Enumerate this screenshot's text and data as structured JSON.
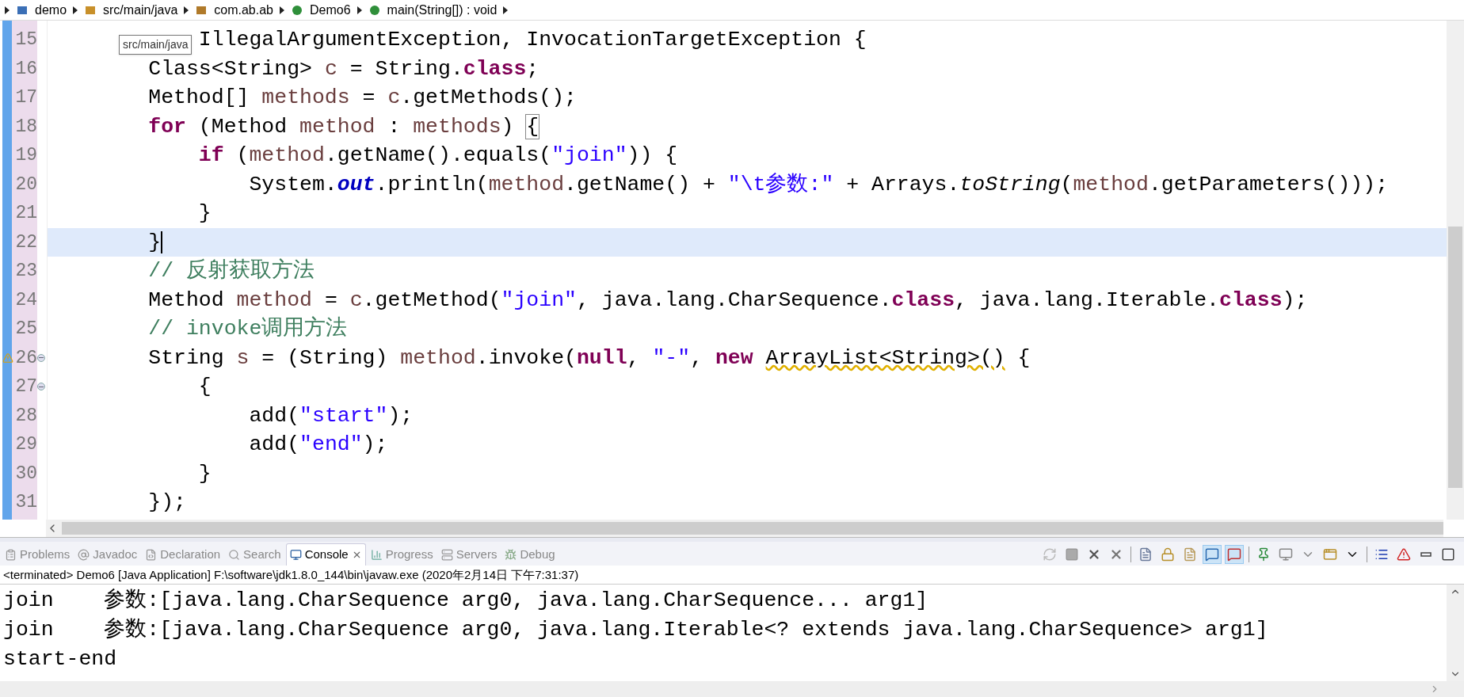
{
  "breadcrumb": [
    {
      "kind": "project",
      "label": "demo"
    },
    {
      "kind": "folder",
      "label": "src/main/java"
    },
    {
      "kind": "package",
      "label": "com.ab.ab"
    },
    {
      "kind": "class",
      "label": "Demo6"
    },
    {
      "kind": "method",
      "label": "main(String[]) : void"
    }
  ],
  "tooltip": "src/main/java",
  "editor": {
    "lines": [
      {
        "number": "15",
        "current": false,
        "warning": false,
        "foldable": false,
        "tokens": [
          {
            "kind": "plain",
            "text": "            IllegalArgumentException, InvocationTargetException {"
          }
        ]
      },
      {
        "number": "16",
        "current": false,
        "warning": false,
        "foldable": false,
        "tokens": [
          {
            "kind": "plain",
            "text": "        Class<String> "
          },
          {
            "kind": "var",
            "text": "c"
          },
          {
            "kind": "plain",
            "text": " = String."
          },
          {
            "kind": "keyword",
            "text": "class"
          },
          {
            "kind": "plain",
            "text": ";"
          }
        ]
      },
      {
        "number": "17",
        "current": false,
        "warning": false,
        "foldable": false,
        "tokens": [
          {
            "kind": "plain",
            "text": "        Method[] "
          },
          {
            "kind": "var",
            "text": "methods"
          },
          {
            "kind": "plain",
            "text": " = "
          },
          {
            "kind": "var",
            "text": "c"
          },
          {
            "kind": "plain",
            "text": ".getMethods();"
          }
        ]
      },
      {
        "number": "18",
        "current": false,
        "warning": false,
        "foldable": false,
        "tokens": [
          {
            "kind": "keyword",
            "text": "        for"
          },
          {
            "kind": "plain",
            "text": " (Method "
          },
          {
            "kind": "var",
            "text": "method"
          },
          {
            "kind": "plain",
            "text": " : "
          },
          {
            "kind": "var",
            "text": "methods"
          },
          {
            "kind": "plain",
            "text": ") "
          },
          {
            "kind": "bracket",
            "text": "{"
          }
        ]
      },
      {
        "number": "19",
        "current": false,
        "warning": false,
        "foldable": false,
        "tokens": [
          {
            "kind": "keyword",
            "text": "            if"
          },
          {
            "kind": "plain",
            "text": " ("
          },
          {
            "kind": "var",
            "text": "method"
          },
          {
            "kind": "plain",
            "text": ".getName().equals("
          },
          {
            "kind": "string",
            "text": "\"join\""
          },
          {
            "kind": "plain",
            "text": ")) {"
          }
        ]
      },
      {
        "number": "20",
        "current": false,
        "warning": false,
        "foldable": false,
        "tokens": [
          {
            "kind": "plain",
            "text": "                System."
          },
          {
            "kind": "field",
            "text": "out"
          },
          {
            "kind": "plain",
            "text": ".println("
          },
          {
            "kind": "var",
            "text": "method"
          },
          {
            "kind": "plain",
            "text": ".getName() + "
          },
          {
            "kind": "string",
            "text": "\"\\t参数:\""
          },
          {
            "kind": "plain",
            "text": " + Arrays."
          },
          {
            "kind": "static",
            "text": "toString"
          },
          {
            "kind": "plain",
            "text": "("
          },
          {
            "kind": "var",
            "text": "method"
          },
          {
            "kind": "plain",
            "text": ".getParameters()));"
          }
        ]
      },
      {
        "number": "21",
        "current": false,
        "warning": false,
        "foldable": false,
        "tokens": [
          {
            "kind": "plain",
            "text": "            }"
          }
        ]
      },
      {
        "number": "22",
        "current": true,
        "warning": false,
        "foldable": false,
        "tokens": [
          {
            "kind": "plain",
            "text": "        }"
          }
        ]
      },
      {
        "number": "23",
        "current": false,
        "warning": false,
        "foldable": false,
        "tokens": [
          {
            "kind": "comment",
            "text": "        // 反射获取方法"
          }
        ]
      },
      {
        "number": "24",
        "current": false,
        "warning": false,
        "foldable": false,
        "tokens": [
          {
            "kind": "plain",
            "text": "        Method "
          },
          {
            "kind": "var",
            "text": "method"
          },
          {
            "kind": "plain",
            "text": " = "
          },
          {
            "kind": "var",
            "text": "c"
          },
          {
            "kind": "plain",
            "text": ".getMethod("
          },
          {
            "kind": "string",
            "text": "\"join\""
          },
          {
            "kind": "plain",
            "text": ", java.lang.CharSequence."
          },
          {
            "kind": "keyword",
            "text": "class"
          },
          {
            "kind": "plain",
            "text": ", java.lang.Iterable."
          },
          {
            "kind": "keyword",
            "text": "class"
          },
          {
            "kind": "plain",
            "text": ");"
          }
        ]
      },
      {
        "number": "25",
        "current": false,
        "warning": false,
        "foldable": false,
        "tokens": [
          {
            "kind": "comment",
            "text": "        // invoke调用方法"
          }
        ]
      },
      {
        "number": "26",
        "current": false,
        "warning": true,
        "foldable": true,
        "tokens": [
          {
            "kind": "plain",
            "text": "        String "
          },
          {
            "kind": "var",
            "text": "s"
          },
          {
            "kind": "plain",
            "text": " = (String) "
          },
          {
            "kind": "var",
            "text": "method"
          },
          {
            "kind": "plain",
            "text": ".invoke("
          },
          {
            "kind": "keyword",
            "text": "null"
          },
          {
            "kind": "plain",
            "text": ", "
          },
          {
            "kind": "string",
            "text": "\"-\""
          },
          {
            "kind": "plain",
            "text": ", "
          },
          {
            "kind": "keyword",
            "text": "new "
          },
          {
            "kind": "squiggle",
            "text": "ArrayList<String>()"
          },
          {
            "kind": "plain",
            "text": " {"
          }
        ]
      },
      {
        "number": "27",
        "current": false,
        "warning": false,
        "foldable": true,
        "tokens": [
          {
            "kind": "plain",
            "text": "            {"
          }
        ]
      },
      {
        "number": "28",
        "current": false,
        "warning": false,
        "foldable": false,
        "tokens": [
          {
            "kind": "plain",
            "text": "                add("
          },
          {
            "kind": "string",
            "text": "\"start\""
          },
          {
            "kind": "plain",
            "text": ");"
          }
        ]
      },
      {
        "number": "29",
        "current": false,
        "warning": false,
        "foldable": false,
        "tokens": [
          {
            "kind": "plain",
            "text": "                add("
          },
          {
            "kind": "string",
            "text": "\"end\""
          },
          {
            "kind": "plain",
            "text": ");"
          }
        ]
      },
      {
        "number": "30",
        "current": false,
        "warning": false,
        "foldable": false,
        "tokens": [
          {
            "kind": "plain",
            "text": "            }"
          }
        ]
      },
      {
        "number": "31",
        "current": false,
        "warning": false,
        "foldable": false,
        "tokens": [
          {
            "kind": "plain",
            "text": "        });"
          }
        ]
      }
    ]
  },
  "panel_tabs": [
    {
      "kind": "problems",
      "label": "Problems",
      "selected": false
    },
    {
      "kind": "javadoc",
      "label": "Javadoc",
      "selected": false
    },
    {
      "kind": "declaration",
      "label": "Declaration",
      "selected": false
    },
    {
      "kind": "search",
      "label": "Search",
      "selected": false
    },
    {
      "kind": "console",
      "label": "Console",
      "selected": true
    },
    {
      "kind": "progress",
      "label": "Progress",
      "selected": false
    },
    {
      "kind": "servers",
      "label": "Servers",
      "selected": false
    },
    {
      "kind": "debug",
      "label": "Debug",
      "selected": false
    }
  ],
  "console_toolbar": [
    [
      {
        "kind": "sync",
        "on": false
      },
      {
        "kind": "stop",
        "on": false
      },
      {
        "kind": "remove",
        "on": false
      },
      {
        "kind": "remove-all",
        "on": false
      }
    ],
    [
      {
        "kind": "clear",
        "on": false
      },
      {
        "kind": "lock",
        "on": false
      },
      {
        "kind": "wrap",
        "on": false
      },
      {
        "kind": "show-out",
        "on": true
      },
      {
        "kind": "show-err",
        "on": true
      }
    ],
    [
      {
        "kind": "pin",
        "on": false
      },
      {
        "kind": "display",
        "on": false
      },
      {
        "kind": "caret",
        "on": false
      },
      {
        "kind": "new",
        "on": false
      },
      {
        "kind": "caret-dark",
        "on": false
      }
    ],
    [
      {
        "kind": "list",
        "on": false
      },
      {
        "kind": "a",
        "on": false
      },
      {
        "kind": "minimize",
        "on": false
      },
      {
        "kind": "maximize",
        "on": false
      }
    ]
  ],
  "console_status": "<terminated> Demo6 [Java Application] F:\\software\\jdk1.8.0_144\\bin\\javaw.exe (2020年2月14日 下午7:31:37)",
  "console_output": [
    "join\t参数:[java.lang.CharSequence arg0, java.lang.CharSequence... arg1]",
    "join\t参数:[java.lang.CharSequence arg0, java.lang.Iterable<? extends java.lang.CharSequence> arg1]",
    "start-end"
  ]
}
